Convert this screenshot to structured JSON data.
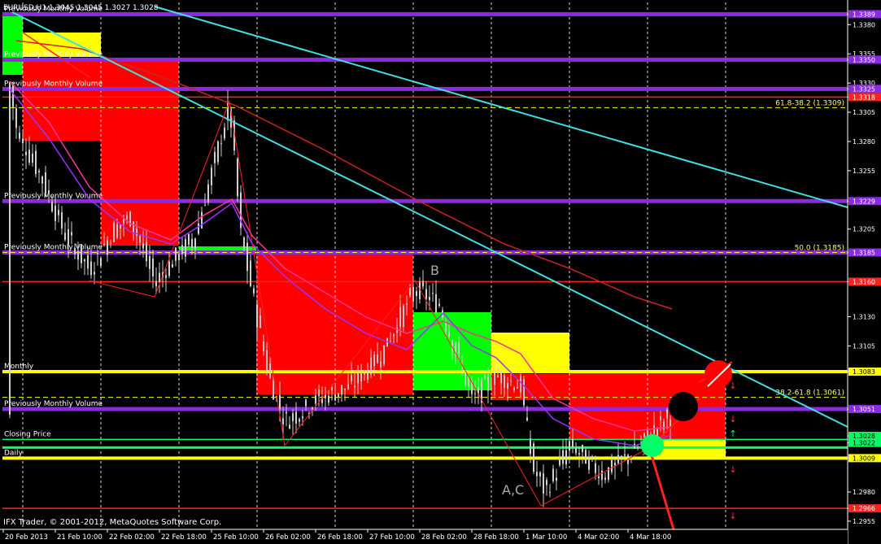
{
  "header": {
    "symbol_info": "EURUSD,H1  1.3045 1.3045 1.3027 1.3028",
    "copyright": "IFX Trader, © 2001-2012, MetaQuotes Software Corp."
  },
  "colors": {
    "background": "#000000",
    "bull_zone": "#00ff00",
    "bear_zone": "#ff0000",
    "neutral_zone": "#ffff00",
    "volume_line": "#8a2be2",
    "trendline": "#40e0e0",
    "ma_red": "#cc2222",
    "ma_pink": "#ff3399",
    "ma_purple": "#9933ff",
    "candles": "#d0d0d0"
  },
  "chart_data": {
    "type": "candlestick",
    "title": "EURUSD,H1",
    "ylim": [
      1.2948,
      1.3399
    ],
    "y_ticks": [
      "1.3389",
      "1.3380",
      "1.3355",
      "1.3350",
      "1.3330",
      "1.3325",
      "1.3318",
      "1.3305",
      "1.3280",
      "1.3255",
      "1.3229",
      "1.3205",
      "1.3185",
      "1.3160",
      "1.3130",
      "1.3105",
      "1.3083",
      "1.3051",
      "1.3028",
      "1.3022",
      "1.3009",
      "1.2980",
      "1.2966",
      "1.2955"
    ],
    "x_ticks": [
      "20 Feb 2013",
      "21 Feb 10:00",
      "22 Feb 02:00",
      "22 Feb 18:00",
      "25 Feb 10:00",
      "26 Feb 02:00",
      "26 Feb 18:00",
      "27 Feb 10:00",
      "28 Feb 02:00",
      "28 Feb 18:00",
      "1 Mar 10:00",
      "4 Mar 02:00",
      "4 Mar 18:00"
    ],
    "price_tags": [
      {
        "value": "1.3389",
        "kind": "volume"
      },
      {
        "value": "1.3350",
        "kind": "volume"
      },
      {
        "value": "1.3325",
        "kind": "volume"
      },
      {
        "value": "1.3318",
        "kind": "resistance"
      },
      {
        "value": "1.3229",
        "kind": "volume"
      },
      {
        "value": "1.3185",
        "kind": "volume"
      },
      {
        "value": "1.3160",
        "kind": "resistance"
      },
      {
        "value": "1.3083",
        "kind": "monthly"
      },
      {
        "value": "1.3051",
        "kind": "volume"
      },
      {
        "value": "1.3028",
        "kind": "close"
      },
      {
        "value": "1.3022",
        "kind": "close"
      },
      {
        "value": "1.3009",
        "kind": "daily"
      },
      {
        "value": "1.2966",
        "kind": "support"
      }
    ],
    "horizontal_levels": [
      {
        "price": 1.3389,
        "kind": "volume",
        "label": "Previously Monthly Volume"
      },
      {
        "price": 1.335,
        "kind": "volume",
        "label": "Previously Monthly Volume"
      },
      {
        "price": 1.3325,
        "kind": "volume",
        "label": "Previously Monthly Volume"
      },
      {
        "price": 1.3318,
        "kind": "resistance",
        "label": ""
      },
      {
        "price": 1.3229,
        "kind": "volume",
        "label": "Previously Monthly Volume"
      },
      {
        "price": 1.3185,
        "kind": "volume",
        "label": "Previously Monthly Volume"
      },
      {
        "price": 1.316,
        "kind": "resistance",
        "label": ""
      },
      {
        "price": 1.3083,
        "kind": "monthly",
        "label": "Monthly"
      },
      {
        "price": 1.3051,
        "kind": "volume",
        "label": "Previously Monthly Volume"
      },
      {
        "price": 1.3025,
        "kind": "close",
        "label": "Closing Price"
      },
      {
        "price": 1.3009,
        "kind": "daily",
        "label": "Daily"
      },
      {
        "price": 1.2966,
        "kind": "support",
        "label": ""
      }
    ],
    "fibo_levels": [
      {
        "price": 1.3309,
        "label": "61.8-38.2 (1.3309)"
      },
      {
        "price": 1.3185,
        "label": "50.0 (1.3185)"
      },
      {
        "price": 1.3061,
        "label": "38.2-61.8 (1.3061)"
      }
    ],
    "annotations": [
      "B",
      "A,C"
    ]
  }
}
